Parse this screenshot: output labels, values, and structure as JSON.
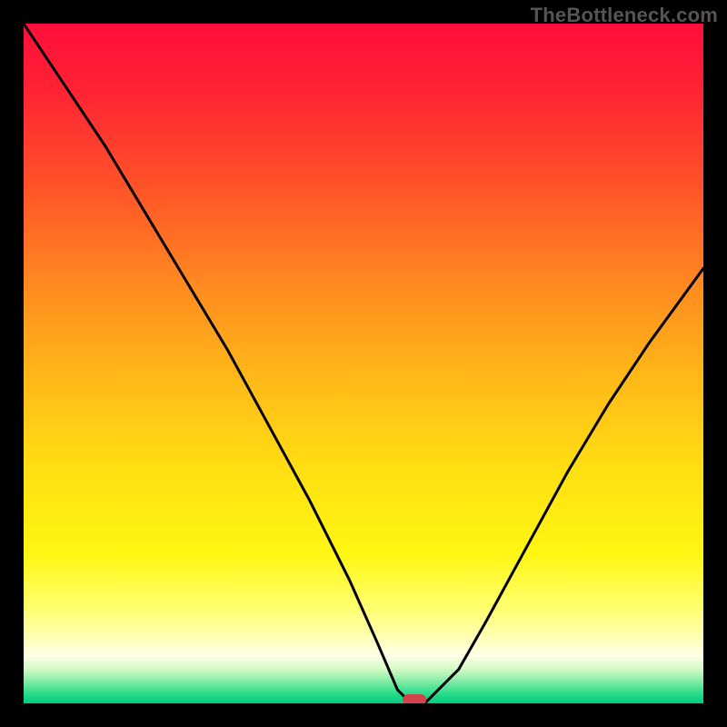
{
  "watermark": "TheBottleneck.com",
  "chart_data": {
    "type": "line",
    "title": "",
    "xlabel": "",
    "ylabel": "",
    "xlim": [
      0,
      100
    ],
    "ylim": [
      0,
      100
    ],
    "x": [
      0,
      6,
      12,
      18,
      24,
      30,
      36,
      42,
      48,
      52,
      55,
      57,
      59,
      64,
      68,
      74,
      80,
      86,
      92,
      100
    ],
    "values": [
      100,
      91,
      82,
      72,
      62,
      52,
      41,
      30,
      18,
      9,
      2,
      0,
      0,
      5,
      12,
      23,
      34,
      44,
      53,
      64
    ],
    "gradient_stops": [
      {
        "offset": 0.0,
        "color": "#ff0e3a"
      },
      {
        "offset": 0.1,
        "color": "#ff2334"
      },
      {
        "offset": 0.24,
        "color": "#ff5328"
      },
      {
        "offset": 0.38,
        "color": "#ff8820"
      },
      {
        "offset": 0.52,
        "color": "#ffb818"
      },
      {
        "offset": 0.66,
        "color": "#ffe012"
      },
      {
        "offset": 0.78,
        "color": "#fff612"
      },
      {
        "offset": 0.86,
        "color": "#ffff70"
      },
      {
        "offset": 0.905,
        "color": "#ffffb8"
      },
      {
        "offset": 0.93,
        "color": "#fdffe8"
      },
      {
        "offset": 0.948,
        "color": "#d8fbc8"
      },
      {
        "offset": 0.962,
        "color": "#9ef0b0"
      },
      {
        "offset": 0.975,
        "color": "#5ce59a"
      },
      {
        "offset": 0.988,
        "color": "#22d988"
      },
      {
        "offset": 1.0,
        "color": "#00ce80"
      }
    ],
    "marker": {
      "x": 57.5,
      "y": 0,
      "color": "#d2434c"
    }
  }
}
